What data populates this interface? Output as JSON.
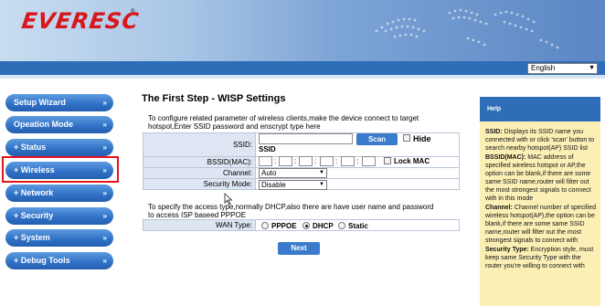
{
  "header": {
    "logo": "EVERESC",
    "trademark": "®",
    "language": "English"
  },
  "sidebar": {
    "items": [
      {
        "label": "Setup Wizard",
        "chevron": "»"
      },
      {
        "label": "Opeation Mode",
        "chevron": "»"
      },
      {
        "label": "+ Status",
        "chevron": "»"
      },
      {
        "label": "+ Wireless",
        "chevron": "»"
      },
      {
        "label": "+ Network",
        "chevron": "»"
      },
      {
        "label": "+ Security",
        "chevron": "»"
      },
      {
        "label": "+ System",
        "chevron": "»"
      },
      {
        "label": "+ Debug Tools",
        "chevron": "»"
      }
    ]
  },
  "main": {
    "title": "The First Step - WISP Settings",
    "description": "To configure related parameter of wireless clients,make the device connect to target hotspot,Enter SSID password and enscrypt type here",
    "ssid_label": "SSID:",
    "scan_label": "Scan",
    "hide_label": "Hide",
    "ssid_value": "SSID",
    "bssid_label": "BSSID(MAC):",
    "colon": ":",
    "lockmac_label": "Lock MAC",
    "channel_label": "Channel:",
    "channel_value": "Auto",
    "security_label": "Security Mode:",
    "security_value": "Disable",
    "description2": "To specify the access type,normally DHCP,also there are have user name and password to access ISP baseed PPPOE",
    "wan_label": "WAN Type:",
    "wan_options": [
      "PPPOE",
      "DHCP",
      "Static"
    ],
    "wan_selected": "DHCP",
    "next_label": "Next"
  },
  "help": {
    "title": "Help",
    "ssid_term": "SSID:",
    "ssid_text": " Displays its SSID name you connected with or click 'scan' button to search nearby hotspot(AP) SSID list",
    "bssid_term": "BSSID(MAC):",
    "bssid_text": " MAC address of specified wireless hotspot or AP,the option can be blank,if there are some same SSID name,router will filter out the most strongest signals to connect with in this mode",
    "channel_term": "Channel:",
    "channel_text": " Channel number of specified wireless hotspot(AP),the option can be blank,if there are some same SSID name,router will filter out the most strongest signals to connect with",
    "security_term": "Security Type:",
    "security_text": " Encryption style, must keep same Security Type with the router you're willing to connect with"
  },
  "colors": {
    "nav_blue": "#2f70c5",
    "header_bar": "#2e6db7",
    "highlight": "#e2151b",
    "help_bg": "#fcefb6"
  }
}
